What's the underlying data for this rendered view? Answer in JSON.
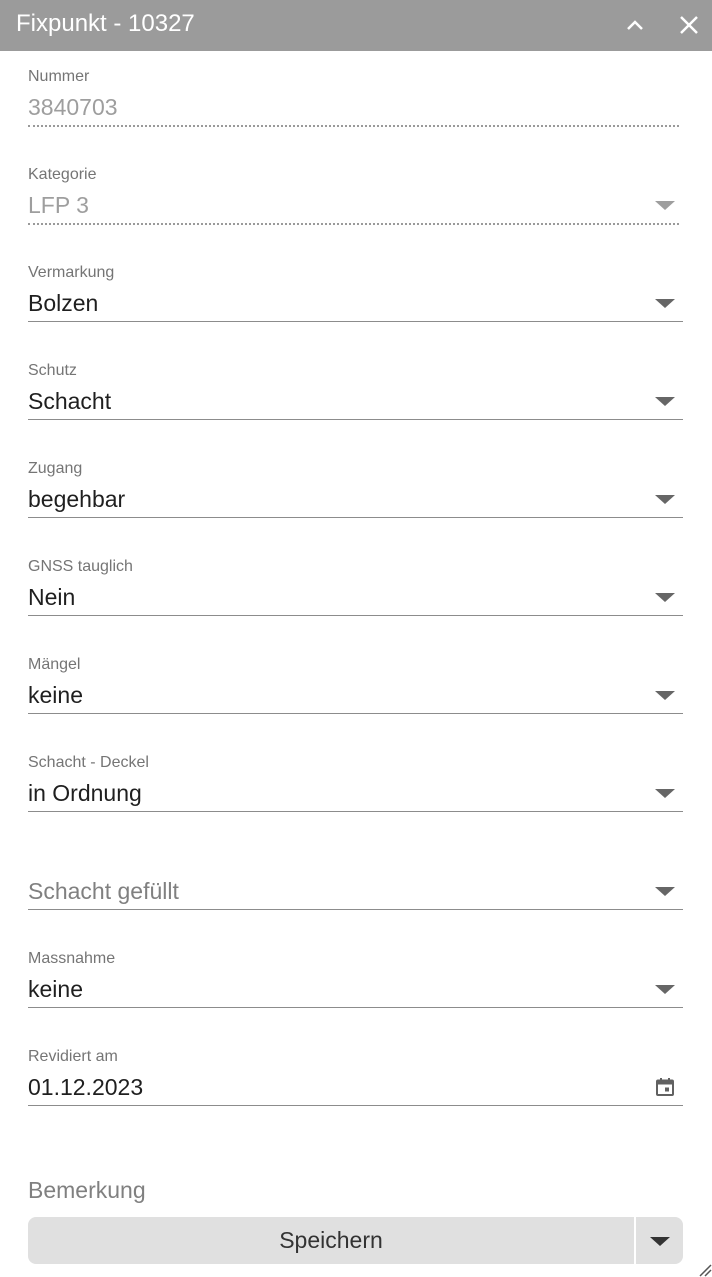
{
  "window": {
    "title": "Fixpunkt - 10327",
    "collapse_icon": "chevron-up-icon",
    "close_icon": "close-icon"
  },
  "fields": {
    "nummer": {
      "label": "Nummer",
      "value": "3840703"
    },
    "kategorie": {
      "label": "Kategorie",
      "value": "LFP 3"
    },
    "vermarkung": {
      "label": "Vermarkung",
      "value": "Bolzen"
    },
    "schutz": {
      "label": "Schutz",
      "value": "Schacht"
    },
    "zugang": {
      "label": "Zugang",
      "value": "begehbar"
    },
    "gnss": {
      "label": "GNSS tauglich",
      "value": "Nein"
    },
    "maengel": {
      "label": "Mängel",
      "value": "keine"
    },
    "deckel": {
      "label": "Schacht - Deckel",
      "value": "in Ordnung"
    },
    "gefuellt": {
      "placeholder": "Schacht gefüllt"
    },
    "massnahme": {
      "label": "Massnahme",
      "value": "keine"
    },
    "revidiert": {
      "label": "Revidiert am",
      "value": "01.12.2023"
    },
    "bemerkung": {
      "placeholder": "Bemerkung"
    }
  },
  "actions": {
    "save_label": "Speichern"
  },
  "colors": {
    "titlebar": "#9b9b9b",
    "save_bg": "#e0e0e0"
  }
}
